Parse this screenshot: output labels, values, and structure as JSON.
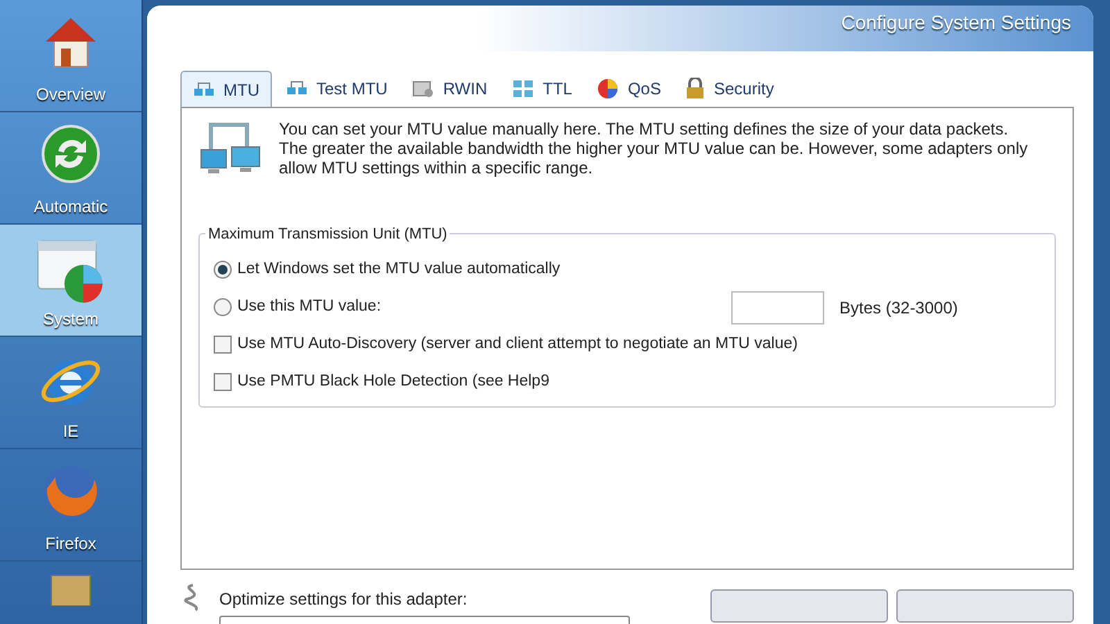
{
  "sidebar": {
    "items": [
      {
        "kind": "house",
        "label": "Overview",
        "selected": false
      },
      {
        "kind": "refresh",
        "label": "Automatic",
        "selected": false
      },
      {
        "kind": "system",
        "label": "System",
        "selected": true
      },
      {
        "kind": "browser-e",
        "label": "IE",
        "selected": false
      },
      {
        "kind": "fox",
        "label": "Firefox",
        "selected": false
      },
      {
        "kind": "tools",
        "selected": false
      }
    ]
  },
  "header": {
    "title": "Configure System Settings"
  },
  "tabs": [
    {
      "kind": "network",
      "label": "MTU",
      "selected": true
    },
    {
      "kind": "network",
      "label": "Test MTU",
      "selected": false
    },
    {
      "kind": "disk",
      "label": "RWIN",
      "selected": false
    },
    {
      "kind": "grid",
      "label": "TTL",
      "selected": false
    },
    {
      "kind": "pie",
      "label": "QoS",
      "selected": false
    },
    {
      "kind": "lock",
      "label": "Security",
      "selected": false
    }
  ],
  "description": "You can set your MTU value manually here. The MTU setting defines the size of your data packets. The greater the available bandwidth the higher your MTU value can be. However, some adapters only allow MTU settings within a specific range.",
  "group": {
    "title": "Maximum Transmission Unit (MTU)",
    "options": [
      {
        "kind": "radio",
        "label": "Let Windows set the MTU value automatically",
        "selected": true
      },
      {
        "kind": "radio",
        "label": "Use this MTU value:",
        "selected": false,
        "unit": "Bytes (32-3000)"
      },
      {
        "kind": "checkbox",
        "label": "Use MTU Auto-Discovery (server and client attempt to negotiate an MTU value)",
        "checked": false
      },
      {
        "kind": "checkbox",
        "label": "Use PMTU Black Hole Detection (see Help9",
        "checked": false
      }
    ]
  },
  "adapter": {
    "label": "Optimize settings for this adapter:"
  }
}
